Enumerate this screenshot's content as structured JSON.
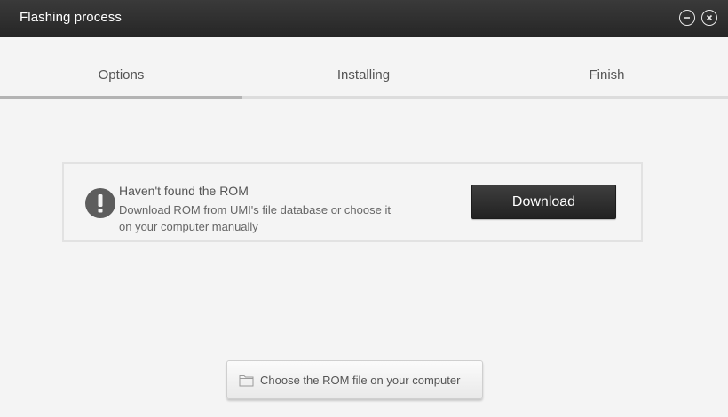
{
  "window": {
    "title": "Flashing process",
    "minimize_icon": "minimize-icon",
    "close_icon": "close-icon"
  },
  "steps": {
    "items": [
      {
        "label": "Options"
      },
      {
        "label": "Installing"
      },
      {
        "label": "Finish"
      }
    ],
    "active_index": 0,
    "progress_fraction": 0.333
  },
  "notice": {
    "icon": "warning-exclamation-icon",
    "heading": "Haven't found the ROM",
    "description_line1": "Download ROM from UMI's file database or choose it",
    "description_line2": "on your computer manually",
    "download_label": "Download"
  },
  "choose_rom": {
    "icon": "folder-icon",
    "label": "Choose the ROM file on your computer"
  },
  "colors": {
    "titlebar": "#2e2e2e",
    "background": "#f4f4f4",
    "progress_fill": "#b3b3b3",
    "progress_track": "#dcdcdc",
    "download_button": "#2b2b2b"
  }
}
